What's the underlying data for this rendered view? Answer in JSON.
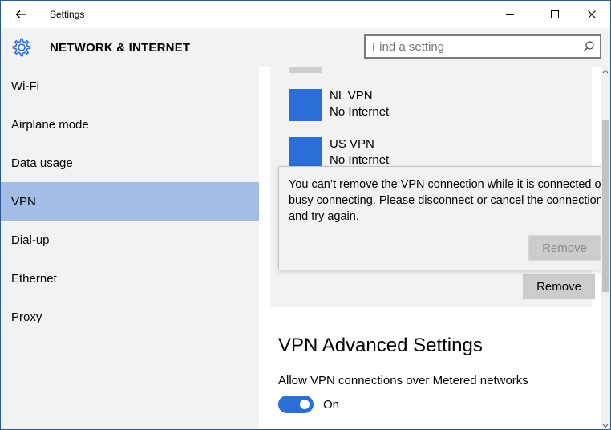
{
  "window": {
    "title": "Settings"
  },
  "header": {
    "title": "NETWORK & INTERNET",
    "search_placeholder": "Find a setting"
  },
  "sidebar": {
    "items": [
      {
        "label": "Wi-Fi",
        "selected": false
      },
      {
        "label": "Airplane mode",
        "selected": false
      },
      {
        "label": "Data usage",
        "selected": false
      },
      {
        "label": "VPN",
        "selected": true
      },
      {
        "label": "Dial-up",
        "selected": false
      },
      {
        "label": "Ethernet",
        "selected": false
      },
      {
        "label": "Proxy",
        "selected": false
      }
    ]
  },
  "vpn_list": [
    {
      "name": "NL VPN",
      "status": "No Internet"
    },
    {
      "name": "US VPN",
      "status": "No Internet"
    }
  ],
  "buttons": {
    "remove_label": "Remove"
  },
  "flyout": {
    "message": "You can’t remove the VPN connection while it is connected or busy connecting. Please disconnect or cancel the connection and try again.",
    "remove_label": "Remove"
  },
  "advanced": {
    "title": "VPN Advanced Settings",
    "metered_label": "Allow VPN connections over Metered networks",
    "metered_toggle_state": "On"
  },
  "colors": {
    "accent": "#2b6fd6",
    "selected_nav": "#a4bde7",
    "panel_bg": "#f2f2f2"
  }
}
